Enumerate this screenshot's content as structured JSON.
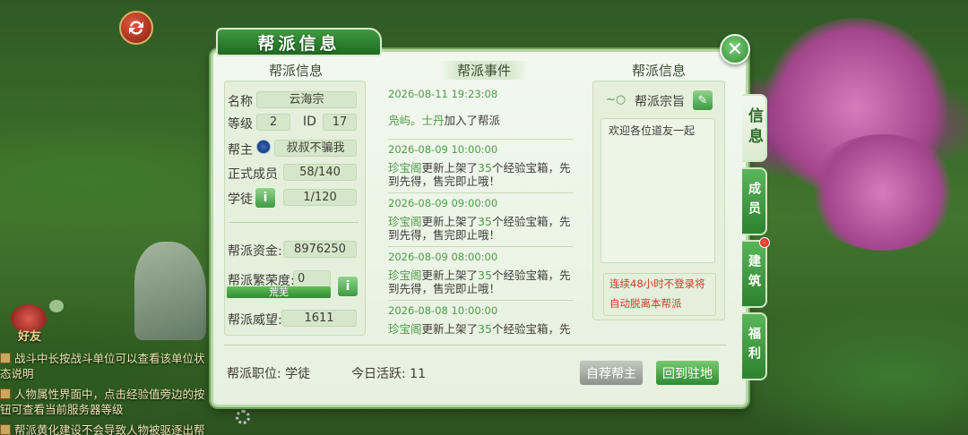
{
  "window": {
    "title": "帮派信息"
  },
  "left": {
    "heading": "帮派信息",
    "name_label": "名称",
    "name_value": "云海宗",
    "level_label": "等级",
    "level_value": "2",
    "id_label": "ID",
    "id_value": "17",
    "leader_label": "帮主",
    "leader_value": "叔叔不骗我",
    "members_label": "正式成员",
    "members_value": "58/140",
    "apprentice_label": "学徒",
    "apprentice_value": "1/120",
    "funds_label": "帮派资金:",
    "funds_value": "8976250",
    "prosperity_label": "帮派繁荣度:",
    "prosperity_value": "0",
    "prosperity_bar_text": "荒芜",
    "prosperity_fraction": 1.0,
    "prestige_label": "帮派威望:",
    "prestige_value": "1611"
  },
  "events": {
    "heading": "帮派事件",
    "items": [
      {
        "time": "2026-08-11 19:23:08",
        "actor": "凫屿。士丹",
        "text": "加入了帮派"
      },
      {
        "time": "2026-08-09 10:00:00",
        "actor": "珍宝阁",
        "text_a": "更新上架了",
        "count": "35",
        "text_b": "个经验宝箱，先到先得，售完即止哦！"
      },
      {
        "time": "2026-08-09 09:00:00",
        "actor": "珍宝阁",
        "text_a": "更新上架了",
        "count": "35",
        "text_b": "个经验宝箱，先到先得，售完即止哦！"
      },
      {
        "time": "2026-08-09 08:00:00",
        "actor": "珍宝阁",
        "text_a": "更新上架了",
        "count": "35",
        "text_b": "个经验宝箱，先到先得，售完即止哦！"
      },
      {
        "time": "2026-08-08 10:00:00",
        "actor": "珍宝阁",
        "text_a": "更新上架了",
        "count": "35",
        "text_b": "个经验宝箱，先到先得，售完即止哦！"
      }
    ]
  },
  "right": {
    "heading": "帮派信息",
    "motto_title": "帮派宗旨",
    "motto_text": "欢迎各位道友一起",
    "warning_line1": "连续48小时不登录将",
    "warning_line2": "自动脱离本帮派"
  },
  "bottom": {
    "position_label": "帮派职位: 学徒",
    "activity_label": "今日活跃: 11",
    "recommend_button": "自荐帮主",
    "return_button": "回到驻地"
  },
  "side_tabs": [
    {
      "label": "信息",
      "active": true
    },
    {
      "label": "成员",
      "active": false
    },
    {
      "label": "建筑",
      "active": false,
      "notify": true
    },
    {
      "label": "福利",
      "active": false
    }
  ],
  "chat": {
    "friend_label": "好友",
    "lines": [
      "战斗中长按战斗单位可以查看该单位状态说明",
      "人物属性界面中，点击经验值旁边的按钮可查看当前服务器等级",
      "帮派黄化建设不会导致人物被驱逐出帮"
    ]
  },
  "colors": {
    "accent_green": "#2f8b33",
    "event_highlight": "#4e9b4a",
    "warning_red": "#d33a2c"
  }
}
